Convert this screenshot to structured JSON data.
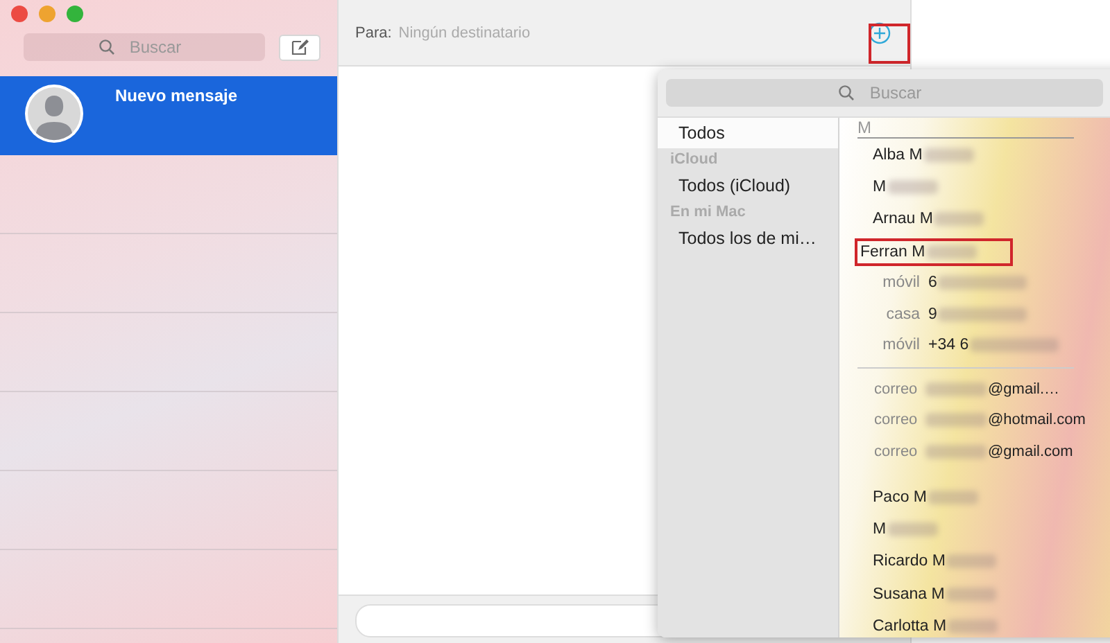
{
  "sidebar": {
    "search": {
      "placeholder": "Buscar"
    },
    "conversations": [
      {
        "name": "Nuevo mensaje",
        "selected": true
      }
    ]
  },
  "compose": {
    "to_label": "Para:",
    "to_placeholder": "Ningún destinatario",
    "add_button_highlighted": true
  },
  "popover": {
    "search": {
      "placeholder": "Buscar"
    },
    "groups": [
      {
        "kind": "item",
        "label": "Todos",
        "selected": true
      },
      {
        "kind": "header",
        "label": "iCloud"
      },
      {
        "kind": "item",
        "label": "Todos (iCloud)",
        "selected": false
      },
      {
        "kind": "header",
        "label": "En mi Mac"
      },
      {
        "kind": "item",
        "label": "Todos los de mi…",
        "selected": false
      }
    ],
    "section_letter": "M",
    "contacts": [
      {
        "name": "Alba M",
        "highlighted": false
      },
      {
        "name": "M",
        "highlighted": false
      },
      {
        "name": "Arnau M",
        "highlighted": false
      },
      {
        "name": "Ferran M",
        "highlighted": true,
        "details": [
          {
            "kind": "phone",
            "label": "móvil",
            "value": "6"
          },
          {
            "kind": "phone",
            "label": "casa",
            "value": "9"
          },
          {
            "kind": "phone",
            "label": "móvil",
            "value": "+34 6"
          },
          {
            "kind": "email",
            "label": "correo",
            "value": "@gmail.…"
          },
          {
            "kind": "email",
            "label": "correo",
            "value": "@hotmail.com"
          },
          {
            "kind": "email",
            "label": "correo",
            "value": "@gmail.com"
          }
        ]
      },
      {
        "name": "Paco M",
        "highlighted": false
      },
      {
        "name": "M",
        "highlighted": false
      },
      {
        "name": "Ricardo M",
        "highlighted": false
      },
      {
        "name": "Susana M",
        "highlighted": false
      },
      {
        "name": "Carlotta M",
        "highlighted": false
      }
    ]
  }
}
